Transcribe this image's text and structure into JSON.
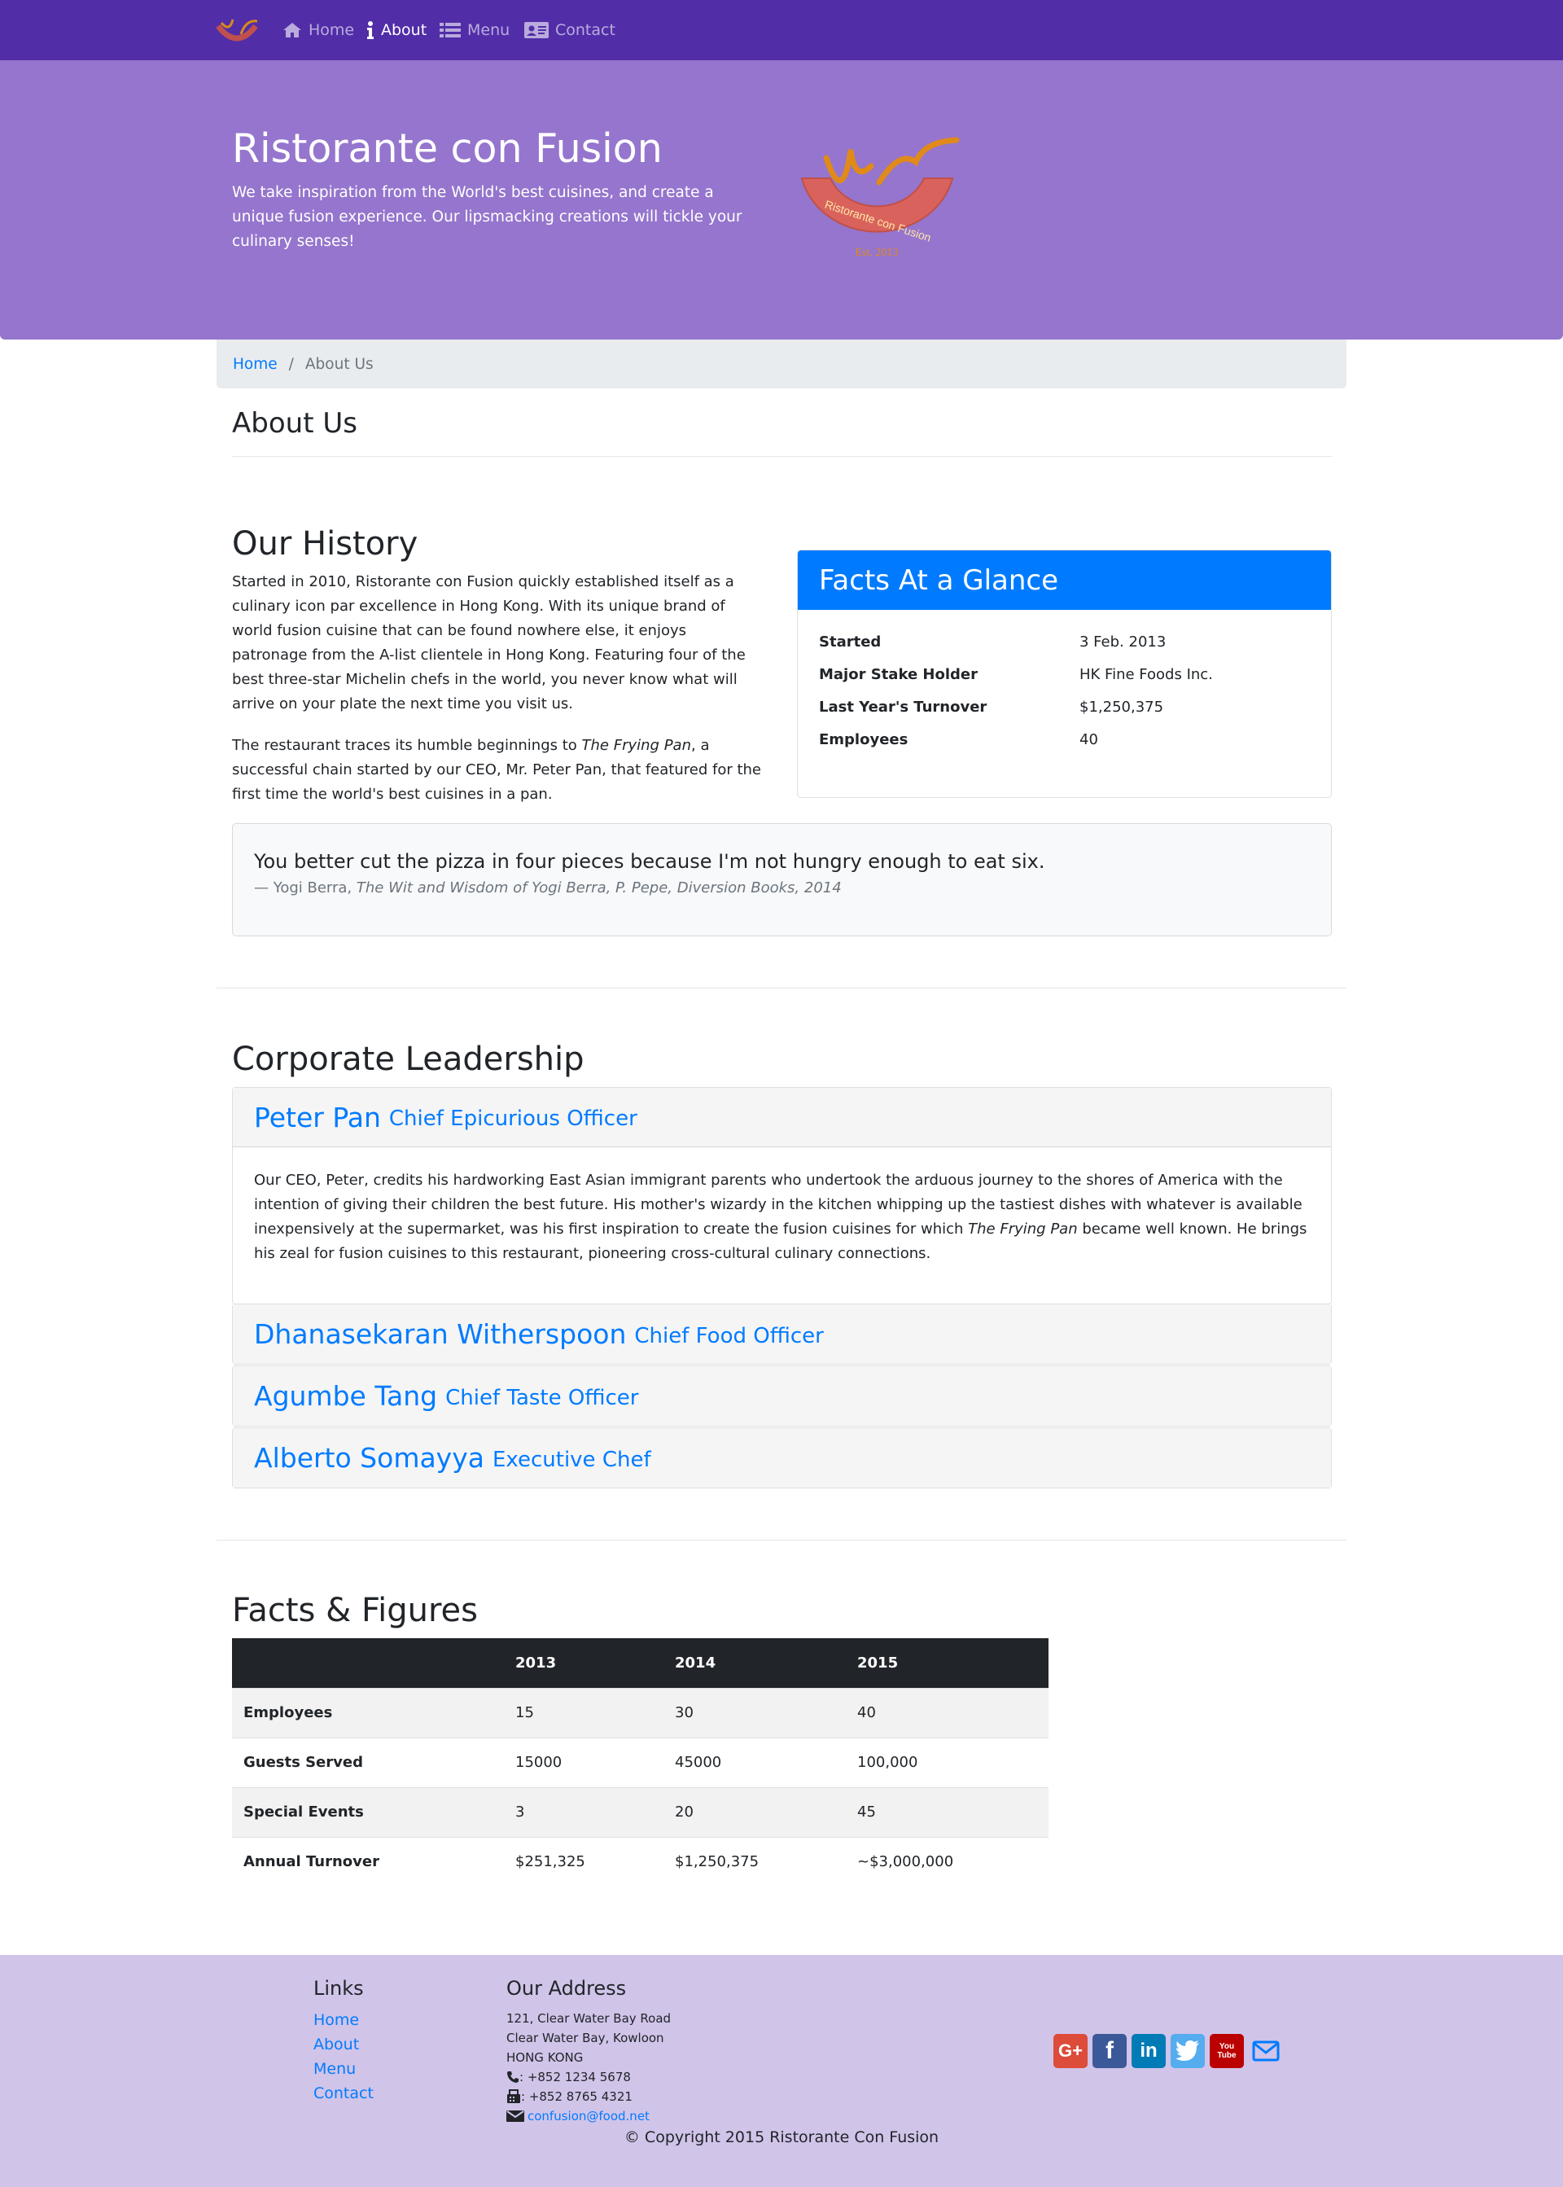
{
  "nav": {
    "items": [
      {
        "label": "Home",
        "icon": "home-icon"
      },
      {
        "label": "About",
        "icon": "info-icon"
      },
      {
        "label": "Menu",
        "icon": "list-icon"
      },
      {
        "label": "Contact",
        "icon": "address-card-icon"
      }
    ],
    "active": "About"
  },
  "jumbotron": {
    "title": "Ristorante con Fusion",
    "text": "We take inspiration from the World's best cuisines, and create a unique fusion experience. Our lipsmacking creations will tickle your culinary senses!",
    "logo_text": "Ristorante con Fusion",
    "logo_est": "Est. 2013"
  },
  "breadcrumb": {
    "home": "Home",
    "current": "About Us"
  },
  "page_title": "About Us",
  "history": {
    "title": "Our History",
    "paragraph1": "Started in 2010, Ristorante con Fusion quickly established itself as a culinary icon par excellence in Hong Kong. With its unique brand of world fusion cuisine that can be found nowhere else, it enjoys patronage from the A-list clientele in Hong Kong. Featuring four of the best three-star Michelin chefs in the world, you never know what will arrive on your plate the next time you visit us.",
    "paragraph2_before": "The restaurant traces its humble beginnings to ",
    "paragraph2_italic": "The Frying Pan",
    "paragraph2_after": ", a successful chain started by our CEO, Mr. Peter Pan, that featured for the first time the world's best cuisines in a pan."
  },
  "facts": {
    "title": "Facts At a Glance",
    "rows": [
      {
        "label": "Started",
        "value": "3 Feb. 2013"
      },
      {
        "label": "Major Stake Holder",
        "value": "HK Fine Foods Inc."
      },
      {
        "label": "Last Year's Turnover",
        "value": "$1,250,375"
      },
      {
        "label": "Employees",
        "value": "40"
      }
    ]
  },
  "quote": {
    "text": "You better cut the pizza in four pieces because I'm not hungry enough to eat six.",
    "author": "— Yogi Berra, ",
    "source": "The Wit and Wisdom of Yogi Berra, P. Pepe, Diversion Books, 2014"
  },
  "leadership": {
    "title": "Corporate Leadership",
    "leaders": [
      {
        "name": "Peter Pan",
        "role": "Chief Epicurious Officer"
      },
      {
        "name": "Dhanasekaran Witherspoon",
        "role": "Chief Food Officer"
      },
      {
        "name": "Agumbe Tang",
        "role": "Chief Taste Officer"
      },
      {
        "name": "Alberto Somayya",
        "role": "Executive Chef"
      }
    ],
    "bio_before": "Our CEO, Peter, credits his hardworking East Asian immigrant parents who undertook the arduous journey to the shores of America with the intention of giving their children the best future. His mother's wizardy in the kitchen whipping up the tastiest dishes with whatever is available inexpensively at the supermarket, was his first inspiration to create the fusion cuisines for which ",
    "bio_italic": "The Frying Pan",
    "bio_after": " became well known. He brings his zeal for fusion cuisines to this restaurant, pioneering cross-cultural culinary connections."
  },
  "figures": {
    "title": "Facts & Figures",
    "columns": [
      "",
      "2013",
      "2014",
      "2015"
    ],
    "rows": [
      {
        "label": "Employees",
        "values": [
          "15",
          "30",
          "40"
        ]
      },
      {
        "label": "Guests Served",
        "values": [
          "15000",
          "45000",
          "100,000"
        ]
      },
      {
        "label": "Special Events",
        "values": [
          "3",
          "20",
          "45"
        ]
      },
      {
        "label": "Annual Turnover",
        "values": [
          "$251,325",
          "$1,250,375",
          "~$3,000,000"
        ]
      }
    ]
  },
  "footer": {
    "links_title": "Links",
    "links": [
      "Home",
      "About",
      "Menu",
      "Contact"
    ],
    "address_title": "Our Address",
    "address": [
      "121, Clear Water Bay Road",
      "Clear Water Bay, Kowloon",
      "HONG KONG"
    ],
    "phone": ": +852 1234 5678",
    "fax": ": +852 8765 4321",
    "email": "confusion@food.net",
    "social": [
      {
        "icon": "google-plus-icon",
        "label": "G+",
        "color": "#dd4b39"
      },
      {
        "icon": "facebook-icon",
        "label": "f",
        "color": "#3b5998"
      },
      {
        "icon": "linkedin-icon",
        "label": "in",
        "color": "#007bb6"
      },
      {
        "icon": "twitter-icon",
        "label": "t",
        "color": "#55acee"
      },
      {
        "icon": "youtube-icon",
        "label": "You Tube",
        "color": "#bb0000"
      },
      {
        "icon": "mail-icon",
        "label": "",
        "color": "#007bff"
      }
    ],
    "copyright": "© Copyright 2015 Ristorante Con Fusion"
  },
  "colors": {
    "navbar": "#512DA8",
    "jumbotron": "#9575CD",
    "footer": "#D1C4E9",
    "primary": "#007bff"
  }
}
